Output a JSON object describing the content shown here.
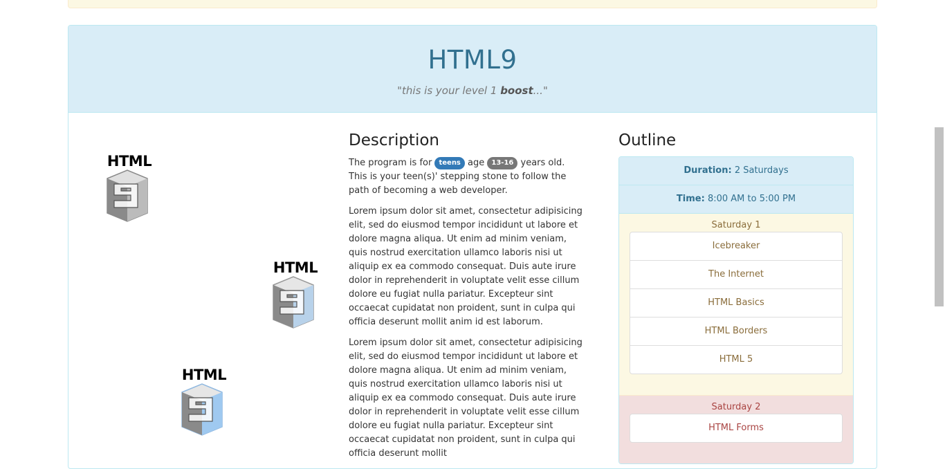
{
  "course": {
    "title": "HTML9",
    "tagline_pre": "\"this is your level 1 ",
    "tagline_bold": "boost",
    "tagline_post": "...\""
  },
  "logos": [
    {
      "word": "HTML",
      "accent": "#bbbbbb"
    },
    {
      "word": "HTML",
      "accent": "#b8d2ea"
    },
    {
      "word": "HTML",
      "accent": "#9fc9f0"
    }
  ],
  "description": {
    "heading": "Description",
    "intro_pre": "The program is for",
    "badge_teens": "teens",
    "intro_mid": "age",
    "badge_age": "13-16",
    "intro_post": "years old. This is your teen(s)' stepping stone to follow the path of becoming a web developer.",
    "paragraphs": [
      "Lorem ipsum dolor sit amet, consectetur adipisicing elit, sed do eiusmod tempor incididunt ut labore et dolore magna aliqua. Ut enim ad minim veniam, quis nostrud exercitation ullamco laboris nisi ut aliquip ex ea commodo consequat. Duis aute irure dolor in reprehenderit in voluptate velit esse cillum dolore eu fugiat nulla pariatur. Excepteur sint occaecat cupidatat non proident, sunt in culpa qui officia deserunt mollit anim id est laborum.",
      "Lorem ipsum dolor sit amet, consectetur adipisicing elit, sed do eiusmod tempor incididunt ut labore et dolore magna aliqua. Ut enim ad minim veniam, quis nostrud exercitation ullamco laboris nisi ut aliquip ex ea commodo consequat. Duis aute irure dolor in reprehenderit in voluptate velit esse cillum dolore eu fugiat nulla pariatur. Excepteur sint occaecat cupidatat non proident, sunt in culpa qui officia deserunt mollit"
    ]
  },
  "outline": {
    "heading": "Outline",
    "duration_label": "Duration:",
    "duration_value": "2 Saturdays",
    "time_label": "Time:",
    "time_value": "8:00 AM to 5:00 PM",
    "saturdays": [
      {
        "title": "Saturday 1",
        "topics": [
          "Icebreaker",
          "The Internet",
          "HTML Basics",
          "HTML Borders",
          "HTML 5"
        ]
      },
      {
        "title": "Saturday 2",
        "topics": [
          "HTML Forms"
        ]
      }
    ]
  }
}
